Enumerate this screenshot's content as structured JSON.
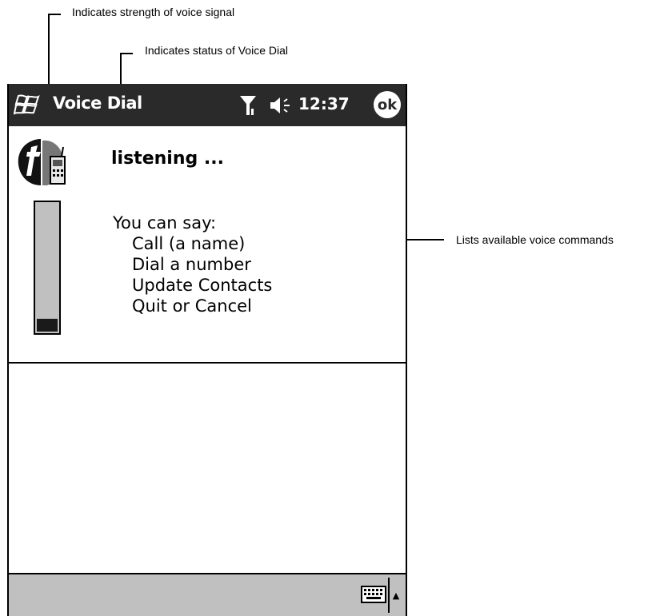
{
  "annotations": {
    "signal_strength": "Indicates strength of voice signal",
    "voice_dial_status": "Indicates status of Voice Dial",
    "voice_commands": "Lists available voice commands"
  },
  "titlebar": {
    "app_title": "Voice Dial",
    "clock": "12:37",
    "ok_label": "ok",
    "start_icon": "windows-flag-icon",
    "signal_icon": "antenna-icon",
    "speaker_icon": "speaker-icon"
  },
  "main": {
    "status": "listening ...",
    "signal_level": 0.1,
    "commands_heading": "You can say:",
    "commands": [
      "Call (a name)",
      "Dial a number",
      "Update Contacts",
      "Quit or Cancel"
    ]
  },
  "bottombar": {
    "input_icon": "keyboard-icon",
    "menu_arrow": "▲"
  },
  "colors": {
    "titlebar": "#2a2a2a",
    "meter_bg": "#c0c0c0",
    "bottombar": "#c0c0c0"
  }
}
